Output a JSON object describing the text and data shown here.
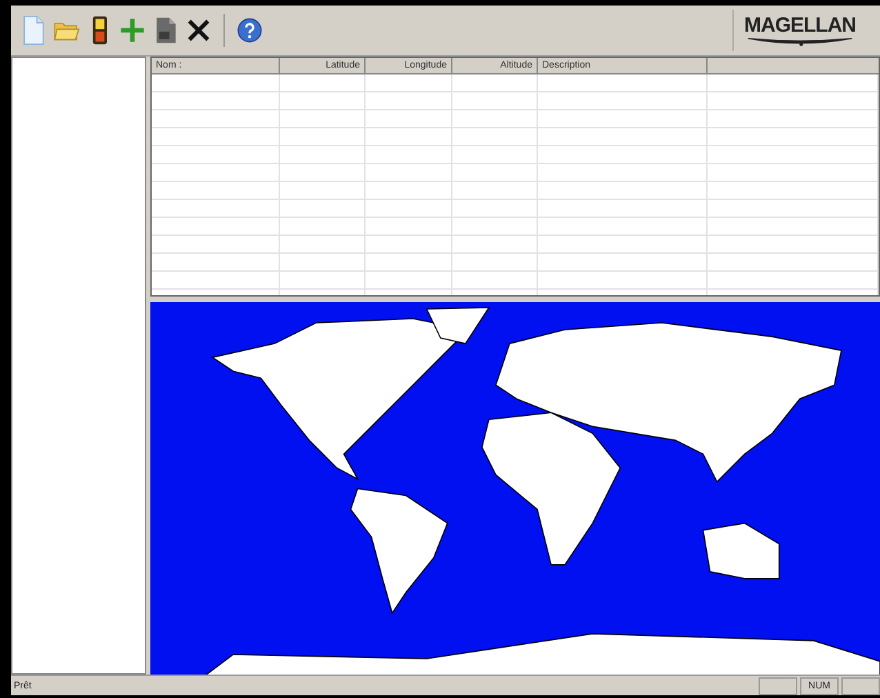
{
  "logo": {
    "text": "MAGELLAN"
  },
  "table": {
    "columns": [
      "Nom :",
      "Latitude",
      "Longitude",
      "Altitude",
      "Description"
    ]
  },
  "status_bar": {
    "message": "Prêt",
    "panels": [
      "NUM"
    ]
  }
}
